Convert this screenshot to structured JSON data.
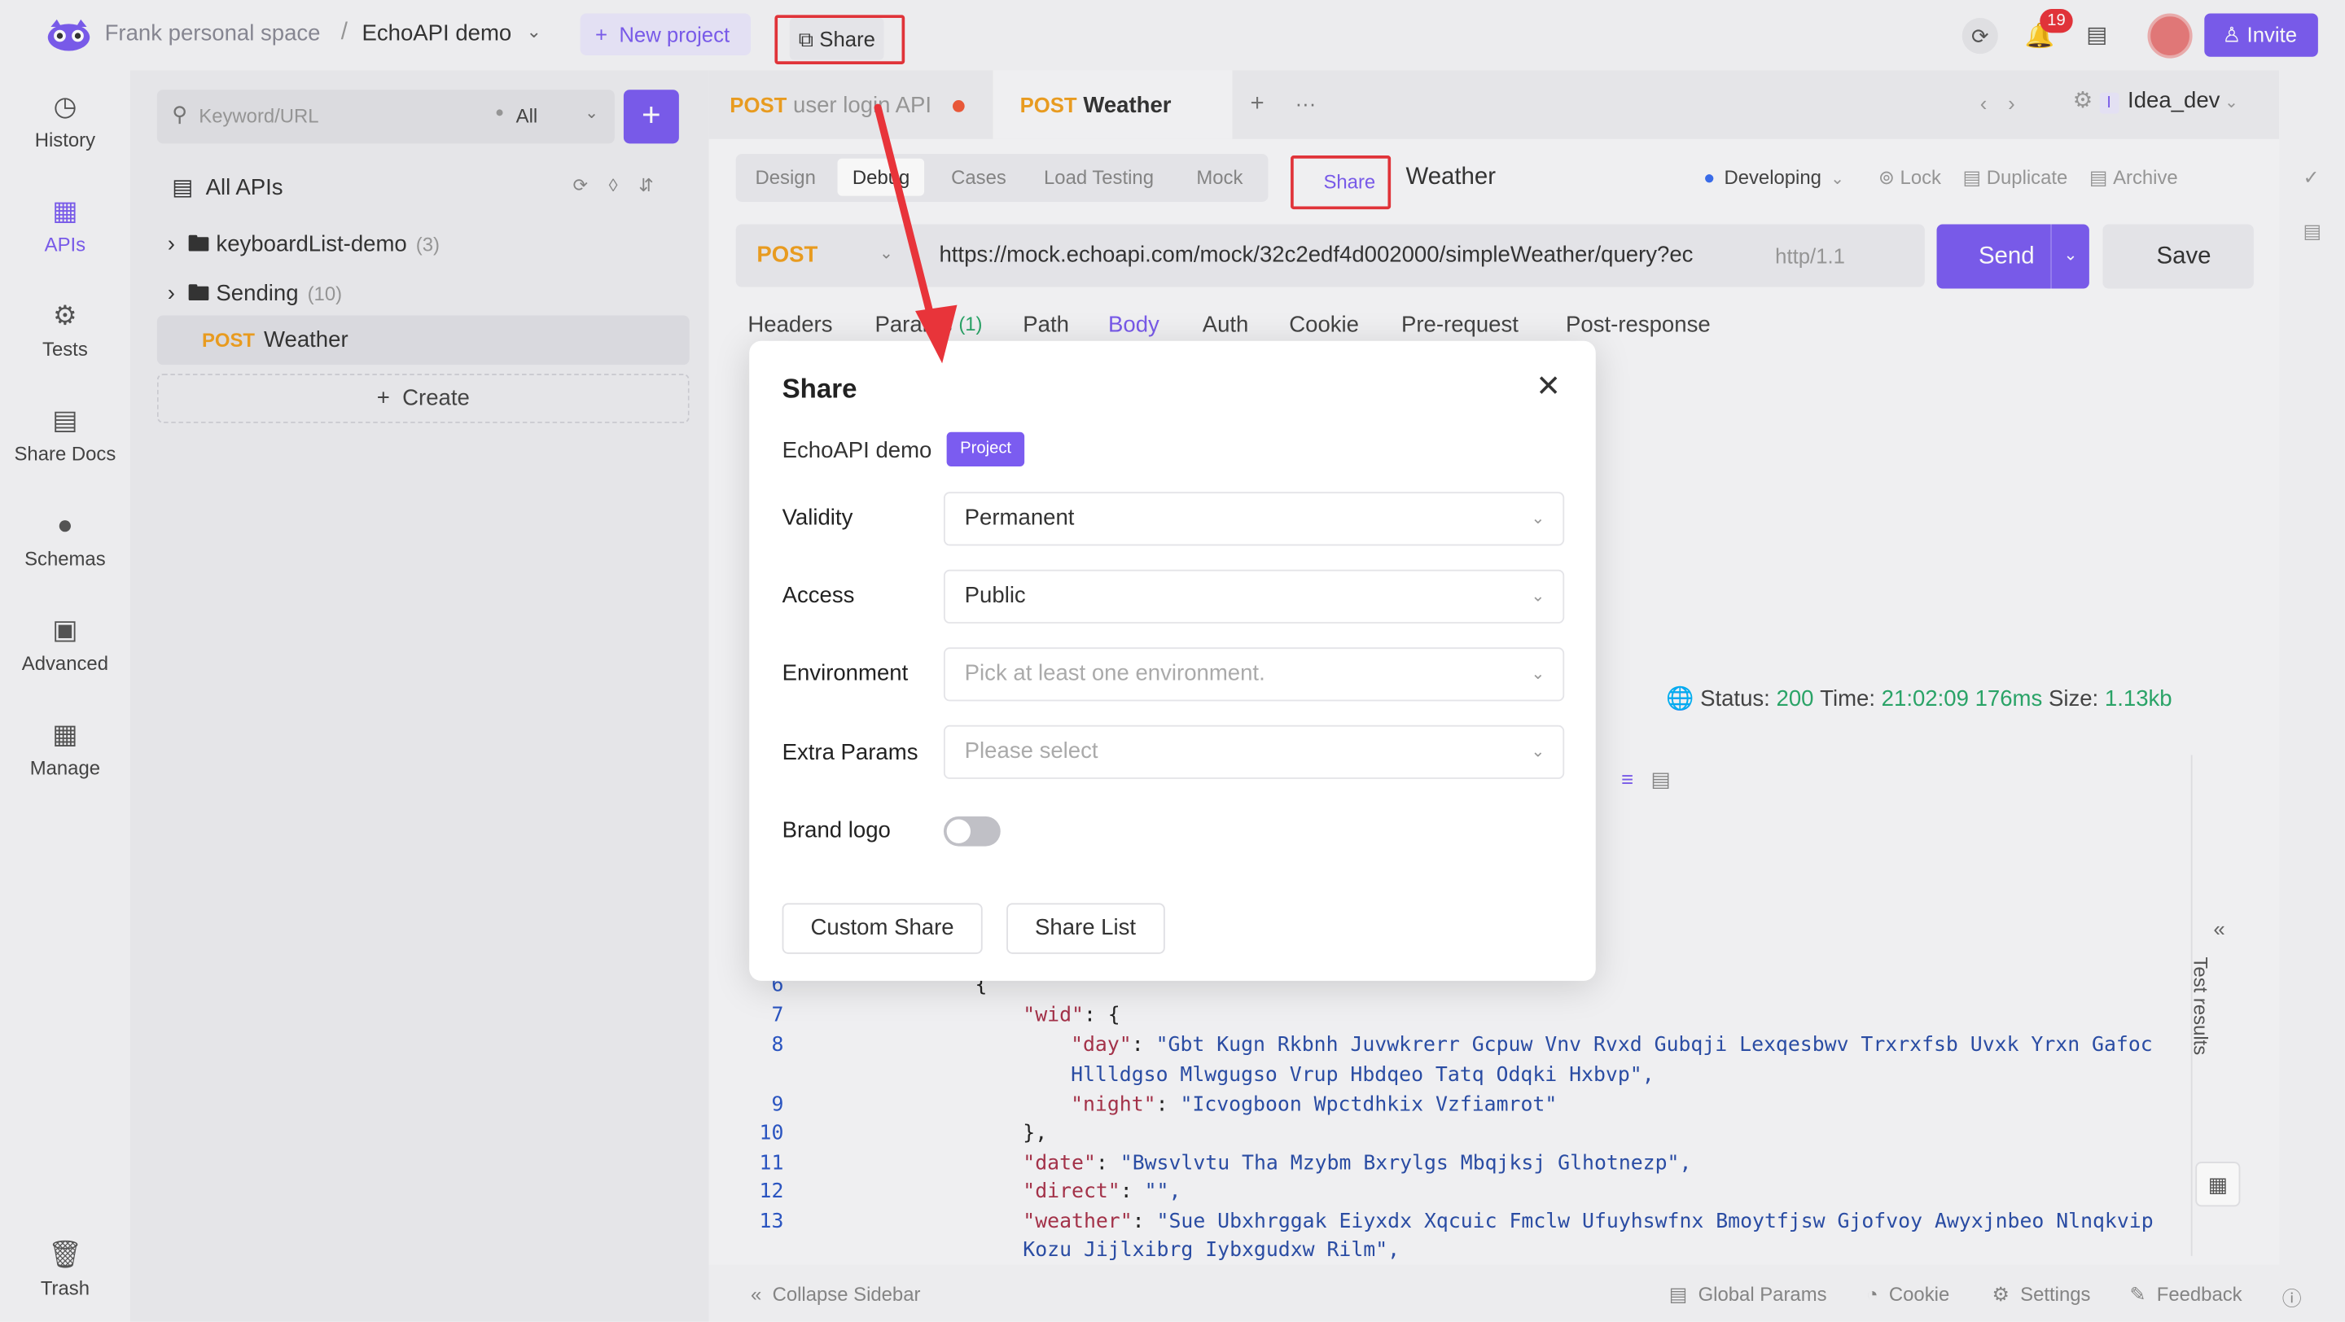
{
  "topbar": {
    "space": "Frank personal space",
    "separator": "/",
    "project": "EchoAPI demo",
    "new_project": "New project",
    "share": "Share",
    "notifications": "19",
    "invite": "Invite"
  },
  "leftnav": {
    "items": [
      {
        "label": "History",
        "icon": "history-icon"
      },
      {
        "label": "APIs",
        "icon": "apis-icon"
      },
      {
        "label": "Tests",
        "icon": "tests-icon"
      },
      {
        "label": "Share Docs",
        "icon": "share-docs-icon"
      },
      {
        "label": "Schemas",
        "icon": "schemas-icon"
      },
      {
        "label": "Advanced",
        "icon": "advanced-icon"
      },
      {
        "label": "Manage",
        "icon": "manage-icon"
      },
      {
        "label": "Trash",
        "icon": "trash-icon"
      }
    ]
  },
  "sidebar": {
    "search_placeholder": "Keyword/URL",
    "filter": "All",
    "all_apis": "All APIs",
    "folders": [
      {
        "name": "keyboardList-demo",
        "count": "(3)"
      },
      {
        "name": "Sending",
        "count": "(10)"
      }
    ],
    "active_api": {
      "method": "POST",
      "name": "Weather"
    },
    "create": "Create"
  },
  "tabs": {
    "tab1": {
      "method": "POST",
      "name": "user login API"
    },
    "tab2": {
      "method": "POST",
      "name": "Weather"
    },
    "env": "Idea_dev",
    "env_badge": "I"
  },
  "subtabs": {
    "items": [
      "Design",
      "Debug",
      "Cases",
      "Load Testing",
      "Mock"
    ],
    "share": "Share",
    "api_name": "Weather",
    "status": "Developing",
    "actions": [
      "Lock",
      "Duplicate",
      "Archive"
    ]
  },
  "request": {
    "method": "POST",
    "url": "https://mock.echoapi.com/mock/32c2edf4d002000/simpleWeather/query?ec",
    "protocol": "http/1.1",
    "send": "Send",
    "save": "Save",
    "tabs": [
      "Headers",
      "Params",
      "(1)",
      "Path",
      "Body",
      "Auth",
      "Cookie",
      "Pre-request",
      "Post-response"
    ]
  },
  "response": {
    "status_label": "Status:",
    "status": "200",
    "time_label": "Time:",
    "time": "21:02:09",
    "duration": "176ms",
    "size_label": "Size:",
    "size": "1.13kb"
  },
  "code": {
    "lines": [
      {
        "n": "6",
        "text": "{"
      },
      {
        "n": "7",
        "key": "\"wid\"",
        "text": ": {"
      },
      {
        "n": "8",
        "key": "\"day\"",
        "value": "\"Gbt Kugn Rkbnh Juvwkrerr Gcpuw Vnv Rvxd Gubqji Lexqesbwv Trxrxfsb Uvxk Yrxn Gafoc"
      },
      {
        "n": "",
        "value": "Hllldgso Mlwgugso Vrup Hbdqeo Tatq Odqki Hxbvp\","
      },
      {
        "n": "9",
        "key": "\"night\"",
        "value": "\"Icvogboon Wpctdhkix Vzfiamrot\""
      },
      {
        "n": "10",
        "text": "},"
      },
      {
        "n": "11",
        "key": "\"date\"",
        "value": "\"Bwsvlvtu Tha Mzybm Bxrylgs Mbqjksj Glhotnezp\","
      },
      {
        "n": "12",
        "key": "\"direct\"",
        "value": "\"\","
      },
      {
        "n": "13",
        "key": "\"weather\"",
        "value": "\"Sue Ubxhrggak Eiyxdx Xqcuic Fmclw Ufuyhswfnx Bmoytfjsw Gjofvoy Awyxjnbeo Nlnqkvip"
      },
      {
        "n": "",
        "value": "Kozu Jijlxibrg Iybxgudxw Rilm\","
      }
    ]
  },
  "test_results": "Test results",
  "footer": {
    "collapse": "Collapse Sidebar",
    "global_params": "Global Params",
    "cookie": "Cookie",
    "settings": "Settings",
    "feedback": "Feedback"
  },
  "modal": {
    "title": "Share",
    "project": "EchoAPI demo",
    "project_badge": "Project",
    "validity_label": "Validity",
    "validity_value": "Permanent",
    "access_label": "Access",
    "access_value": "Public",
    "environment_label": "Environment",
    "environment_placeholder": "Pick at least one environment.",
    "extra_label": "Extra Params",
    "extra_placeholder": "Please select",
    "brand_label": "Brand logo",
    "brand_on": false,
    "custom_share": "Custom Share",
    "share_list": "Share List"
  },
  "colors": {
    "accent": "#7b5cf0",
    "highlight": "#e8343a",
    "post": "#f0a020",
    "success": "#2aa86a"
  }
}
